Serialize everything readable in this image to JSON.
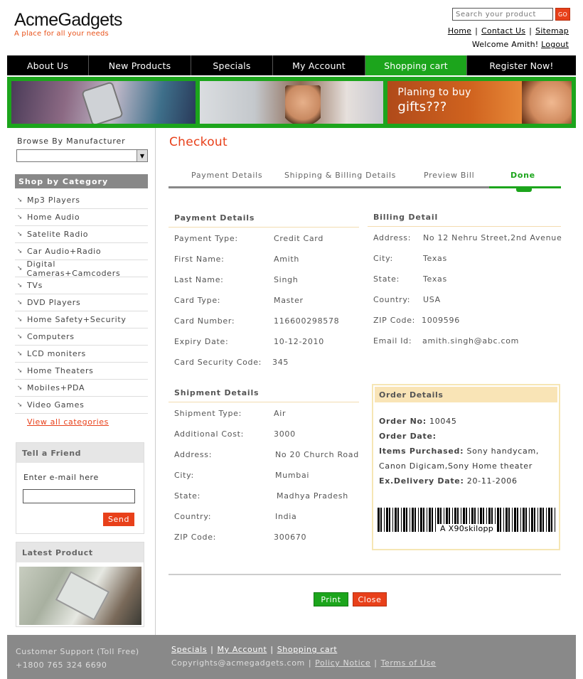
{
  "brand": {
    "name": "AcmeGadgets",
    "tagline": "A place for all your needs"
  },
  "search": {
    "placeholder": "Search your product",
    "go_label": "GO"
  },
  "top_links": [
    "Home",
    "Contact Us",
    "Sitemap"
  ],
  "welcome": {
    "text": "Welcome Amith!",
    "logout": "Logout"
  },
  "nav": [
    {
      "label": "About Us"
    },
    {
      "label": "New Products"
    },
    {
      "label": "Specials"
    },
    {
      "label": "My Account"
    },
    {
      "label": "Shopping cart",
      "active": true
    },
    {
      "label": "Register Now!"
    }
  ],
  "banner": {
    "promo_line1": "Planing to buy",
    "promo_line2": "gifts???"
  },
  "sidebar": {
    "browse_label": "Browse By Manufacturer",
    "browse_value": "",
    "category_heading": "Shop by Category",
    "categories": [
      "Mp3 Players",
      "Home Audio",
      "Satelite Radio",
      "Car Audio+Radio",
      "Digital Cameras+Camcoders",
      "TVs",
      "DVD Players",
      "Home Safety+Security",
      "Computers",
      "LCD moniters",
      "Home Theaters",
      "Mobiles+PDA",
      "Video Games"
    ],
    "view_all": "View all categories",
    "tell_friend": {
      "heading": "Tell a Friend",
      "label": "Enter e-mail here",
      "value": "",
      "send": "Send"
    },
    "latest_product": {
      "heading": "Latest Product"
    }
  },
  "main": {
    "title": "Checkout",
    "steps": [
      {
        "label": "Payment Details"
      },
      {
        "label": "Shipping & Billing Details"
      },
      {
        "label": "Preview Bill"
      },
      {
        "label": "Done",
        "active": true
      }
    ],
    "payment": {
      "heading": "Payment Details",
      "rows": [
        {
          "k": "Payment Type:",
          "v": "Credit Card"
        },
        {
          "k": "First Name:",
          "v": "Amith"
        },
        {
          "k": "Last Name:",
          "v": "Singh"
        },
        {
          "k": "Card Type:",
          "v": "Master"
        },
        {
          "k": "Card Number:",
          "v": "116600298578"
        },
        {
          "k": "Expiry Date:",
          "v": "10-12-2010"
        },
        {
          "k": "Card Security Code:",
          "v": "345"
        }
      ]
    },
    "billing": {
      "heading": "Billing Detail",
      "rows": [
        {
          "k": "Address:",
          "v": "No 12 Nehru Street,2nd Avenue"
        },
        {
          "k": "City:",
          "v": "Texas"
        },
        {
          "k": "State:",
          "v": "Texas"
        },
        {
          "k": "Country:",
          "v": "USA"
        },
        {
          "k": "ZIP Code:",
          "v": "1009596"
        },
        {
          "k": "Email Id:",
          "v": "amith.singh@abc.com"
        }
      ]
    },
    "shipment": {
      "heading": "Shipment Details",
      "rows": [
        {
          "k": "Shipment Type:",
          "v": "Air"
        },
        {
          "k": "Additional Cost:",
          "v": "3000"
        },
        {
          "k": "Address:",
          "v": "No 20 Church Road"
        },
        {
          "k": "City:",
          "v": "Mumbai"
        },
        {
          "k": "State:",
          "v": "Madhya Pradesh"
        },
        {
          "k": "Country:",
          "v": "India"
        },
        {
          "k": "ZIP Code:",
          "v": "300670"
        }
      ]
    },
    "order": {
      "heading": "Order Details",
      "order_no_label": "Order No:",
      "order_no": "10045",
      "order_date_label": "Order Date:",
      "order_date": "",
      "items_label": "Items Purchased:",
      "items_line1": "Sony handycam,",
      "items_line2": "Canon Digicam,Sony Home theater",
      "delivery_label": "Ex.Delivery Date:",
      "delivery_date": "20-11-2006",
      "barcode_text": "A X90skilopp"
    },
    "buttons": {
      "print": "Print",
      "close": "Close"
    }
  },
  "footer": {
    "support_label": "Customer Support (Toll Free)",
    "support_phone": "+1800 765 324 6690",
    "links": [
      "Specials",
      "My Account",
      "Shopping cart"
    ],
    "copyright": "Copyrights@acmegadgets.com",
    "legal_links": [
      "Policy Notice",
      "Terms of Use"
    ]
  },
  "colors": {
    "accent_orange": "#e8401a",
    "accent_green": "#1ca51c",
    "nav_black": "#000000",
    "footer_grey": "#898989"
  }
}
